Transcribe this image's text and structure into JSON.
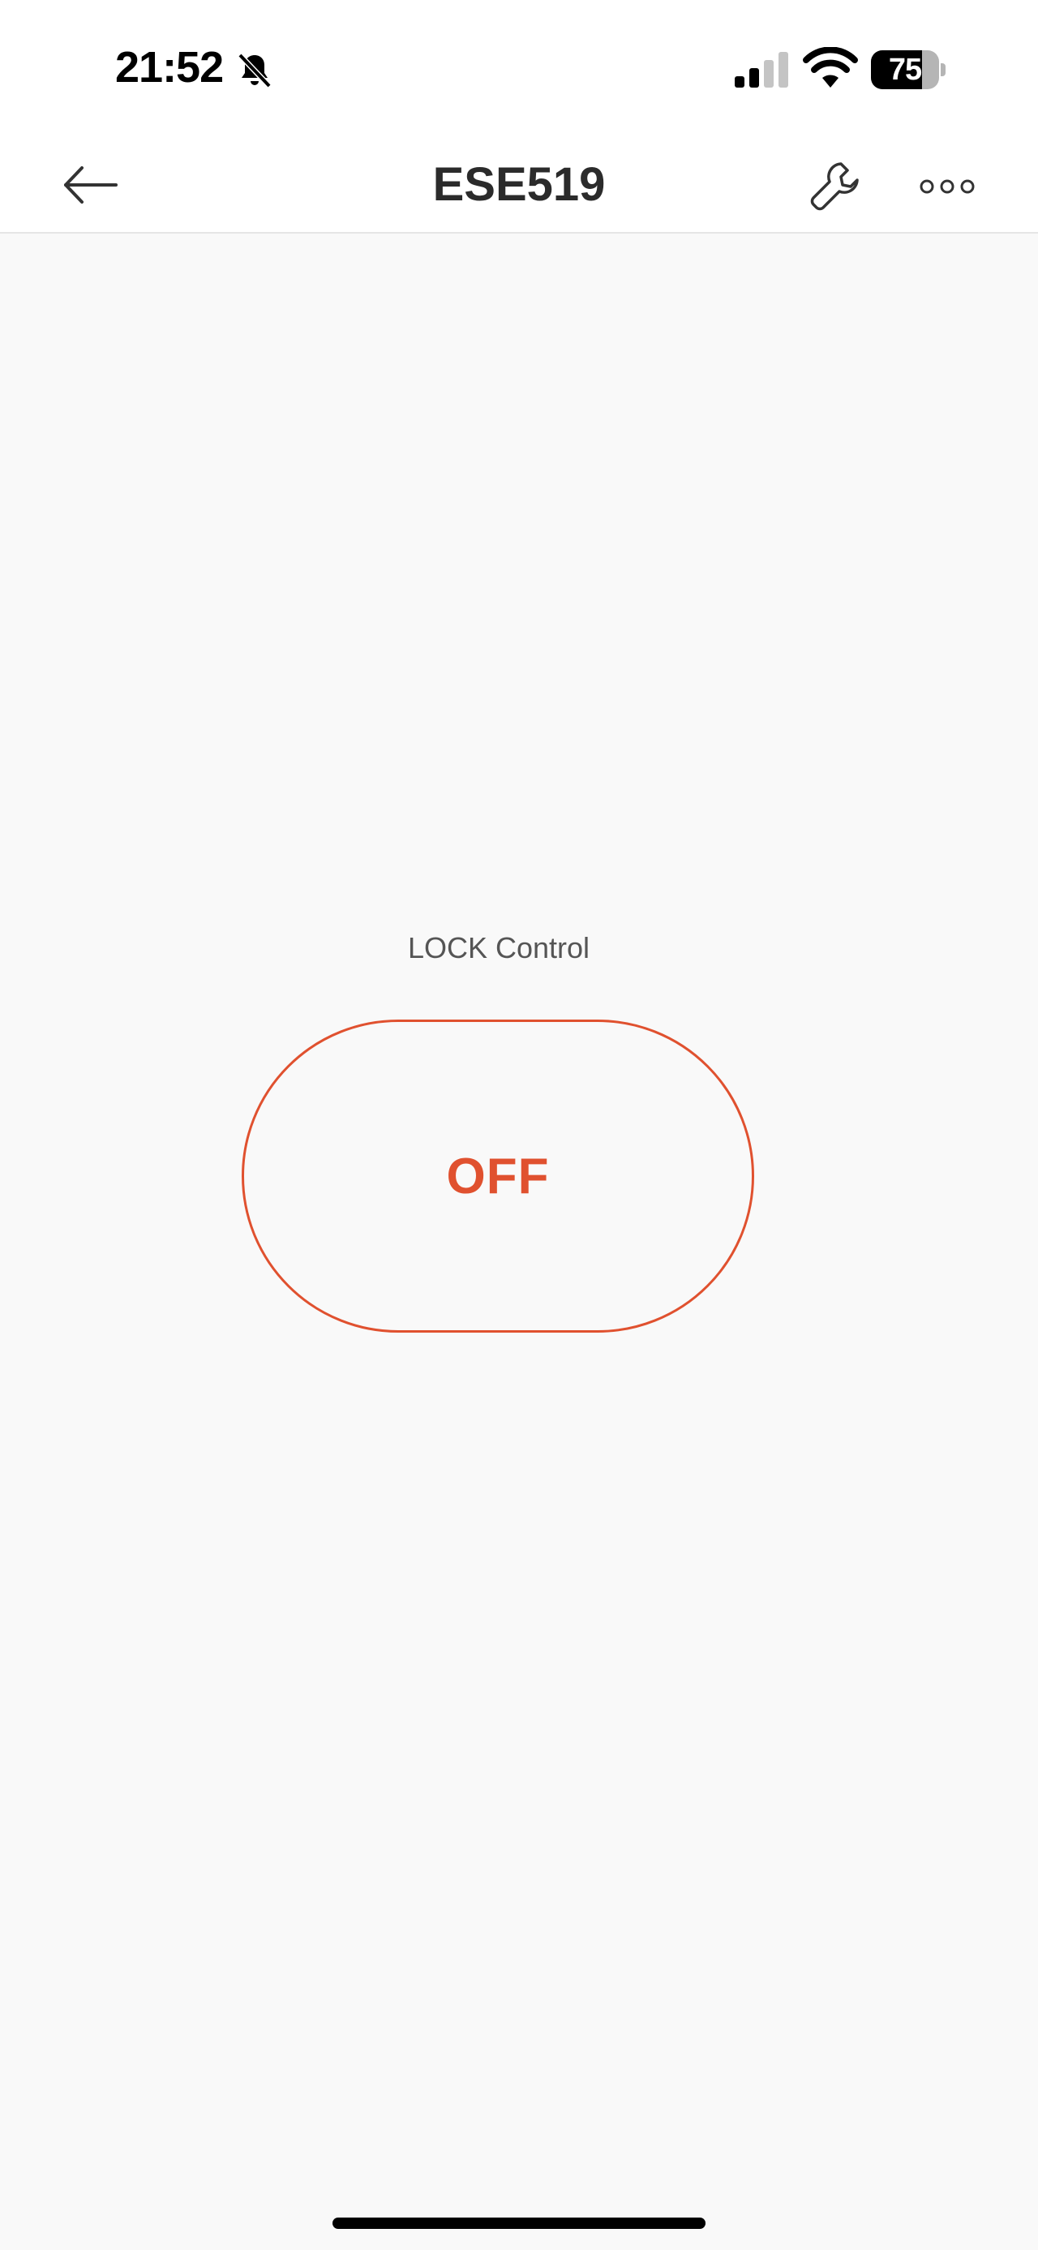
{
  "status_bar": {
    "time": "21:52",
    "battery_level": "75",
    "battery_fraction": 0.75,
    "icons": {
      "bell": "bell-off-icon",
      "signal": "cellular-signal-icon",
      "wifi": "wifi-icon",
      "battery": "battery-icon"
    }
  },
  "nav": {
    "title": "ESE519",
    "back_icon": "arrow-left-icon",
    "settings_icon": "wrench-icon",
    "more_icon": "more-dots-icon"
  },
  "widget": {
    "label": "LOCK Control",
    "state_label": "OFF",
    "accent_color": "#e0512f"
  }
}
